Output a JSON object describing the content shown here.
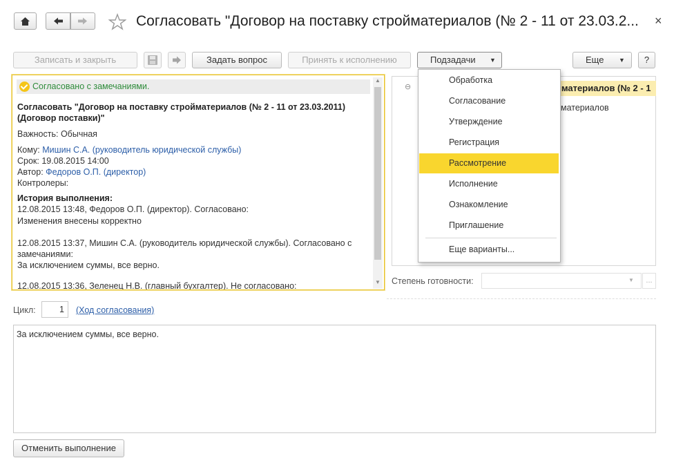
{
  "window": {
    "title": "Согласовать \"Договор на поставку стройматериалов (№ 2 - 11 от 23.03.2...",
    "close_glyph": "×"
  },
  "toolbar": {
    "save_close": "Записать и закрыть",
    "ask_question": "Задать вопрос",
    "accept": "Принять к исполнению",
    "subtasks": "Подзадачи",
    "more": "Еще",
    "help": "?"
  },
  "task": {
    "status": "Согласовано с замечаниями.",
    "heading_line1": "Согласовать \"Договор на поставку стройматериалов (№ 2 - 11 от 23.03.2011)",
    "heading_line2": "(Договор поставки)\"",
    "importance_label": "Важность:",
    "importance_value": "Обычная",
    "to_label": "Кому:",
    "to_value": "Мишин С.А. (руководитель юридической службы)",
    "due_label": "Срок:",
    "due_value": "19.08.2015 14:00",
    "author_label": "Автор:",
    "author_value": "Федоров О.П. (директор)",
    "controllers_label": "Контролеры:",
    "history_title": "История выполнения:",
    "history": [
      "12.08.2015 13:48, Федоров О.П. (директор). Согласовано:",
      "Изменения внесены корректно",
      "12.08.2015 13:37, Мишин С.А. (руководитель юридической службы). Согласовано с",
      "замечаниями:",
      "За исключением суммы, все верно.",
      "12.08.2015 13:36, Зеленец Н.В. (главный бухгалтер). Не согласовано:"
    ]
  },
  "right_tree": {
    "row1": "йматериалов (№ 2 - 1",
    "row2": "йматериалов",
    "collapse_glyph": "⊖"
  },
  "subtasks_menu": {
    "items": [
      "Обработка",
      "Согласование",
      "Утверждение",
      "Регистрация",
      "Рассмотрение",
      "Исполнение",
      "Ознакомление",
      "Приглашение"
    ],
    "selected": "Рассмотрение",
    "more_variants": "Еще варианты..."
  },
  "readiness": {
    "label": "Степень готовности:",
    "value": "",
    "ellipsis": "..."
  },
  "cycle": {
    "label": "Цикл:",
    "value": "1",
    "link": "(Ход согласования)"
  },
  "comment": "За исключением суммы, все верно.",
  "cancel_button": "Отменить выполнение",
  "colors": {
    "accent": "#f9d62e",
    "link": "#2c5ea8",
    "status_green": "#2e8b3a"
  }
}
